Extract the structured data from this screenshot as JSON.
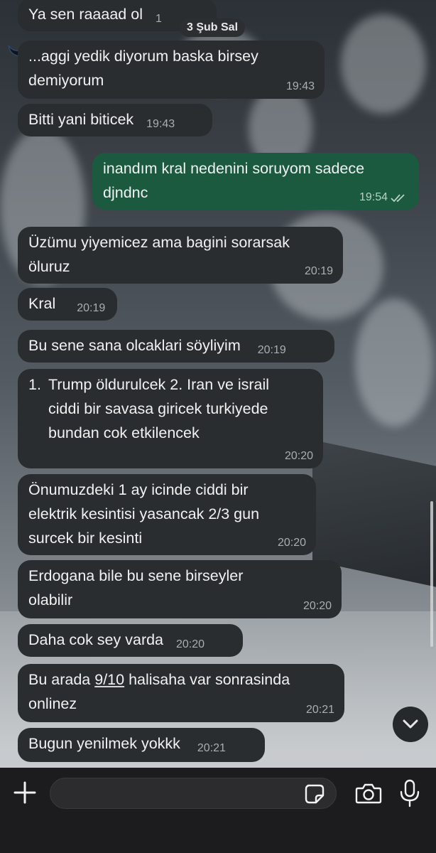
{
  "date_chip": "3 Şub Sal",
  "messages": [
    {
      "text": "Ya sen raaaad ol",
      "time": "1",
      "dir": "in"
    },
    {
      "text": "...aggi yedik diyorum baska birsey demiyorum",
      "line1": "...aggi yedik diyorum baska birsey",
      "line2": "demiyorum",
      "time": "19:43",
      "dir": "in"
    },
    {
      "text": "Bitti yani biticek",
      "time": "19:43",
      "dir": "in"
    },
    {
      "line1": "inandım kral nedenini soruyom sadece",
      "line2": "djndnc",
      "time": "19:54",
      "dir": "out",
      "status": "read"
    },
    {
      "line1": "Üzümu yiyemicez ama bagini sorarsak",
      "line2": "öluruz",
      "time": "20:19",
      "dir": "in"
    },
    {
      "text": "Kral",
      "time": "20:19",
      "dir": "in"
    },
    {
      "text": "Bu sene sana olcaklari söyliyim",
      "time": "20:19",
      "dir": "in"
    },
    {
      "list_start": "1.",
      "line1": "Trump öldurulcek 2. Iran ve israil",
      "line2": "ciddi bir savasa giricek turkiyede",
      "line3": "bundan cok etkilencek",
      "time": "20:20",
      "dir": "in"
    },
    {
      "line1": "Önumuzdeki 1 ay icinde ciddi bir",
      "line2": "elektrik kesintisi yasancak 2/3 gun",
      "line3": "surcek bir kesinti",
      "time": "20:20",
      "dir": "in"
    },
    {
      "line1": "Erdogana bile bu sene birseyler",
      "line2": "olabilir",
      "time": "20:20",
      "dir": "in"
    },
    {
      "text": "Daha cok sey varda",
      "time": "20:20",
      "dir": "in"
    },
    {
      "pre": "Bu arada ",
      "link": "9/10",
      "post": " halisaha var sonrasinda",
      "line2": "onlinez",
      "time": "20:21",
      "dir": "in"
    },
    {
      "text": "Bugun yenilmek yokkk",
      "time": "20:21",
      "dir": "in"
    }
  ],
  "composer": {
    "placeholder": ""
  },
  "icons": {
    "add": "plus-icon",
    "sticker": "sticker-icon",
    "camera": "camera-icon",
    "mic": "microphone-icon",
    "scroll": "chevron-down-icon",
    "read": "double-check-icon"
  },
  "colors": {
    "incoming": "#2a2d30",
    "outgoing": "#1b5a3f",
    "bar": "#1c1c1e"
  }
}
